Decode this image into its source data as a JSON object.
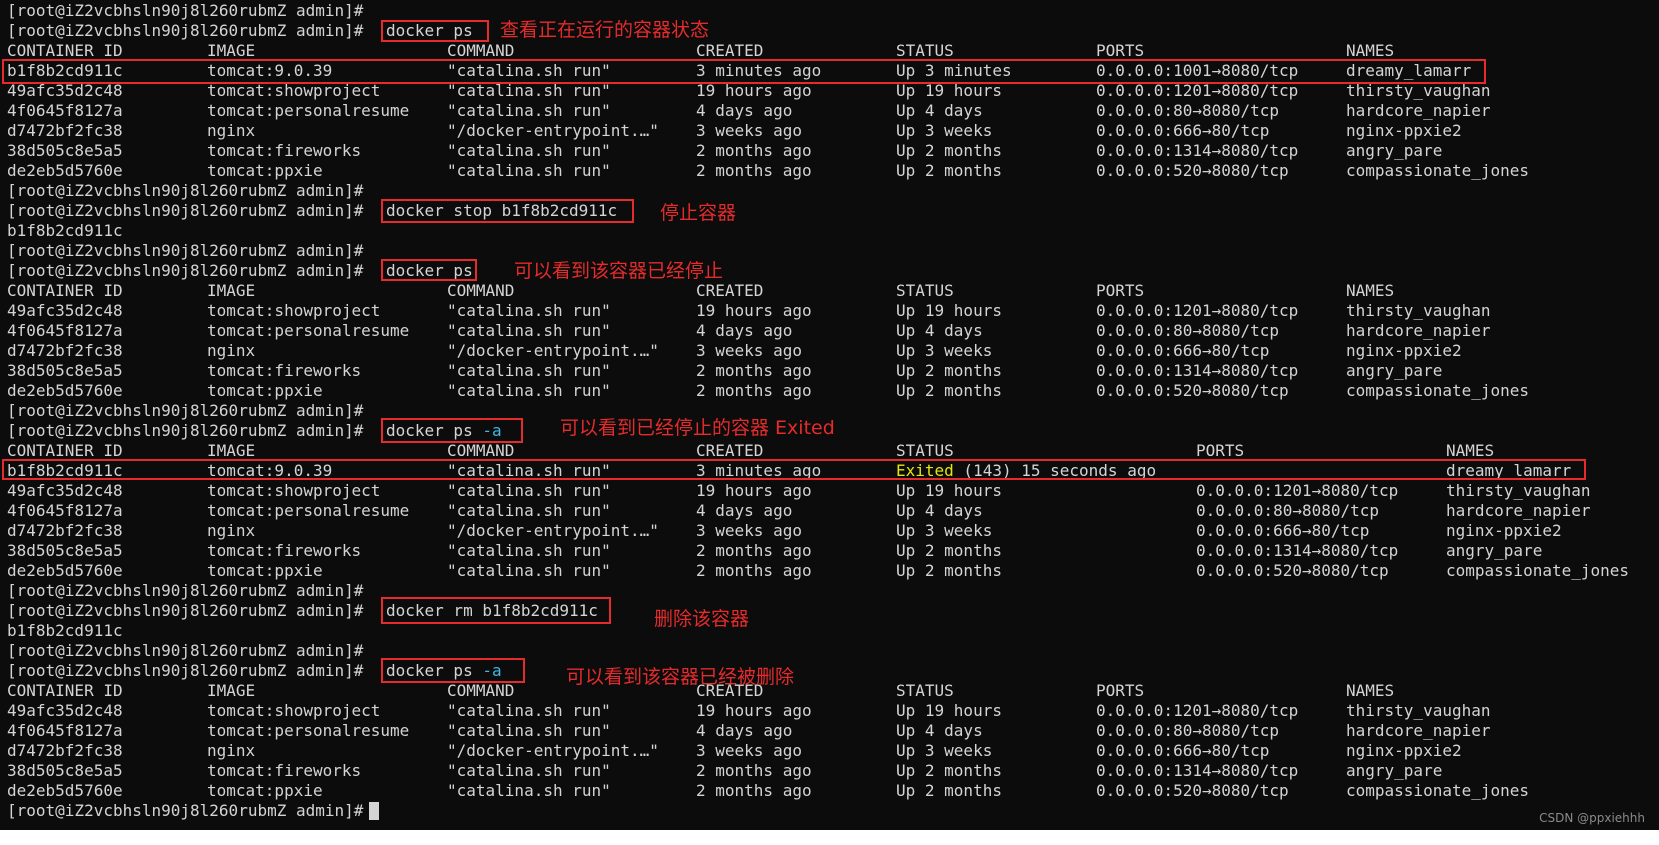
{
  "prompt": "[root@iZ2vcbhsln90j8l260rubmZ admin]#",
  "commands": {
    "ps1": "docker ps",
    "stop": "docker stop b1f8b2cd911c",
    "ps2": "docker ps",
    "ps_a1_base": "docker ps ",
    "ps_a1_flag": "-a",
    "rm": "docker rm b1f8b2cd911c",
    "ps_a2_base": "docker ps ",
    "ps_a2_flag": "-a"
  },
  "outputs": {
    "stop_result": "b1f8b2cd911c",
    "rm_result": "b1f8b2cd911c"
  },
  "headers": {
    "container_id": "CONTAINER ID",
    "image": "IMAGE",
    "command": "COMMAND",
    "created": "CREATED",
    "status": "STATUS",
    "ports": "PORTS",
    "names": "NAMES"
  },
  "tables": {
    "ps1": [
      {
        "id": "b1f8b2cd911c",
        "image": "tomcat:9.0.39",
        "command": "\"catalina.sh run\"",
        "created": "3 minutes ago",
        "status": "Up 3 minutes",
        "ports": "0.0.0.0:1001→8080/tcp",
        "names": "dreamy_lamarr"
      },
      {
        "id": "49afc35d2c48",
        "image": "tomcat:showproject",
        "command": "\"catalina.sh run\"",
        "created": "19 hours ago",
        "status": "Up 19 hours",
        "ports": "0.0.0.0:1201→8080/tcp",
        "names": "thirsty_vaughan"
      },
      {
        "id": "4f0645f8127a",
        "image": "tomcat:personalresume",
        "command": "\"catalina.sh run\"",
        "created": "4 days ago",
        "status": "Up 4 days",
        "ports": "0.0.0.0:80→8080/tcp",
        "names": "hardcore_napier"
      },
      {
        "id": "d7472bf2fc38",
        "image": "nginx",
        "command": "\"/docker-entrypoint.…\"",
        "created": "3 weeks ago",
        "status": "Up 3 weeks",
        "ports": "0.0.0.0:666→80/tcp",
        "names": "nginx-ppxie2"
      },
      {
        "id": "38d505c8e5a5",
        "image": "tomcat:fireworks",
        "command": "\"catalina.sh run\"",
        "created": "2 months ago",
        "status": "Up 2 months",
        "ports": "0.0.0.0:1314→8080/tcp",
        "names": "angry_pare"
      },
      {
        "id": "de2eb5d5760e",
        "image": "tomcat:ppxie",
        "command": "\"catalina.sh run\"",
        "created": "2 months ago",
        "status": "Up 2 months",
        "ports": "0.0.0.0:520→8080/tcp",
        "names": "compassionate_jones"
      }
    ],
    "ps2": [
      {
        "id": "49afc35d2c48",
        "image": "tomcat:showproject",
        "command": "\"catalina.sh run\"",
        "created": "19 hours ago",
        "status": "Up 19 hours",
        "ports": "0.0.0.0:1201→8080/tcp",
        "names": "thirsty_vaughan"
      },
      {
        "id": "4f0645f8127a",
        "image": "tomcat:personalresume",
        "command": "\"catalina.sh run\"",
        "created": "4 days ago",
        "status": "Up 4 days",
        "ports": "0.0.0.0:80→8080/tcp",
        "names": "hardcore_napier"
      },
      {
        "id": "d7472bf2fc38",
        "image": "nginx",
        "command": "\"/docker-entrypoint.…\"",
        "created": "3 weeks ago",
        "status": "Up 3 weeks",
        "ports": "0.0.0.0:666→80/tcp",
        "names": "nginx-ppxie2"
      },
      {
        "id": "38d505c8e5a5",
        "image": "tomcat:fireworks",
        "command": "\"catalina.sh run\"",
        "created": "2 months ago",
        "status": "Up 2 months",
        "ports": "0.0.0.0:1314→8080/tcp",
        "names": "angry_pare"
      },
      {
        "id": "de2eb5d5760e",
        "image": "tomcat:ppxie",
        "command": "\"catalina.sh run\"",
        "created": "2 months ago",
        "status": "Up 2 months",
        "ports": "0.0.0.0:520→8080/tcp",
        "names": "compassionate_jones"
      }
    ],
    "ps_a1": [
      {
        "id": "b1f8b2cd911c",
        "image": "tomcat:9.0.39",
        "command": "\"catalina.sh run\"",
        "created": "3 minutes ago",
        "status_word": "Exited",
        "status_rest": " (143) 15 seconds ago",
        "ports": "",
        "names": "dreamy_lamarr"
      },
      {
        "id": "49afc35d2c48",
        "image": "tomcat:showproject",
        "command": "\"catalina.sh run\"",
        "created": "19 hours ago",
        "status": "Up 19 hours",
        "ports": "0.0.0.0:1201→8080/tcp",
        "names": "thirsty_vaughan"
      },
      {
        "id": "4f0645f8127a",
        "image": "tomcat:personalresume",
        "command": "\"catalina.sh run\"",
        "created": "4 days ago",
        "status": "Up 4 days",
        "ports": "0.0.0.0:80→8080/tcp",
        "names": "hardcore_napier"
      },
      {
        "id": "d7472bf2fc38",
        "image": "nginx",
        "command": "\"/docker-entrypoint.…\"",
        "created": "3 weeks ago",
        "status": "Up 3 weeks",
        "ports": "0.0.0.0:666→80/tcp",
        "names": "nginx-ppxie2"
      },
      {
        "id": "38d505c8e5a5",
        "image": "tomcat:fireworks",
        "command": "\"catalina.sh run\"",
        "created": "2 months ago",
        "status": "Up 2 months",
        "ports": "0.0.0.0:1314→8080/tcp",
        "names": "angry_pare"
      },
      {
        "id": "de2eb5d5760e",
        "image": "tomcat:ppxie",
        "command": "\"catalina.sh run\"",
        "created": "2 months ago",
        "status": "Up 2 months",
        "ports": "0.0.0.0:520→8080/tcp",
        "names": "compassionate_jones"
      }
    ],
    "ps_a2": [
      {
        "id": "49afc35d2c48",
        "image": "tomcat:showproject",
        "command": "\"catalina.sh run\"",
        "created": "19 hours ago",
        "status": "Up 19 hours",
        "ports": "0.0.0.0:1201→8080/tcp",
        "names": "thirsty_vaughan"
      },
      {
        "id": "4f0645f8127a",
        "image": "tomcat:personalresume",
        "command": "\"catalina.sh run\"",
        "created": "4 days ago",
        "status": "Up 4 days",
        "ports": "0.0.0.0:80→8080/tcp",
        "names": "hardcore_napier"
      },
      {
        "id": "d7472bf2fc38",
        "image": "nginx",
        "command": "\"/docker-entrypoint.…\"",
        "created": "3 weeks ago",
        "status": "Up 3 weeks",
        "ports": "0.0.0.0:666→80/tcp",
        "names": "nginx-ppxie2"
      },
      {
        "id": "38d505c8e5a5",
        "image": "tomcat:fireworks",
        "command": "\"catalina.sh run\"",
        "created": "2 months ago",
        "status": "Up 2 months",
        "ports": "0.0.0.0:1314→8080/tcp",
        "names": "angry_pare"
      },
      {
        "id": "de2eb5d5760e",
        "image": "tomcat:ppxie",
        "command": "\"catalina.sh run\"",
        "created": "2 months ago",
        "status": "Up 2 months",
        "ports": "0.0.0.0:520→8080/tcp",
        "names": "compassionate_jones"
      }
    ]
  },
  "annotations": {
    "ps1": "查看正在运行的容器状态",
    "stop": "停止容器",
    "ps2": "可以看到该容器已经停止",
    "ps_a1": "可以看到已经停止的容器 Exited",
    "rm": "删除该容器",
    "ps_a2": "可以看到该容器已经被删除"
  },
  "watermark": "CSDN @ppxiehhh",
  "colors": {
    "background": "#0c0c0c",
    "foreground": "#d4d4d4",
    "highlight_box": "#e52b2b",
    "flag": "#3fb8e8",
    "exited": "#e5e510"
  }
}
